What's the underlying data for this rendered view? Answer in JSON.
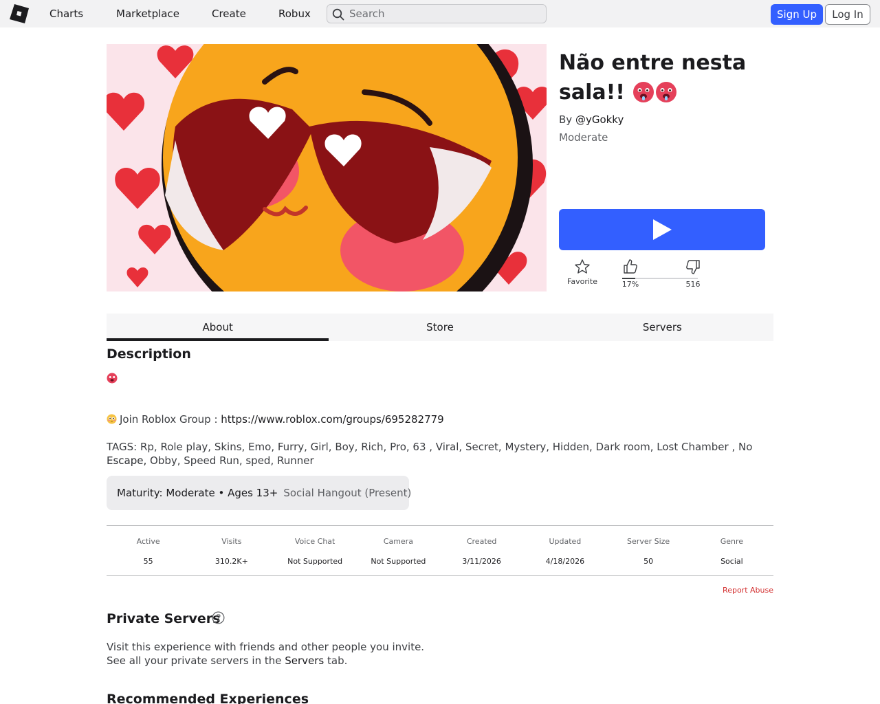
{
  "nav": {
    "links": [
      "Charts",
      "Marketplace",
      "Create",
      "Robux"
    ],
    "search_placeholder": "Search",
    "signup_label": "Sign Up",
    "login_label": "Log In"
  },
  "game": {
    "title": "Não entre nesta sala!!",
    "creator_prefix": "By ",
    "creator_name": "@yGokky",
    "maturity": "Moderate",
    "accent_color": "#335fff"
  },
  "votes": {
    "favorite_label": "Favorite",
    "upvote_label": "17%",
    "downvote_label": "516",
    "upvote_fraction": 0.17
  },
  "tabs": [
    {
      "label": "About",
      "active": true
    },
    {
      "label": "Store",
      "active": false
    },
    {
      "label": "Servers",
      "active": false
    }
  ],
  "description": {
    "heading": "Description",
    "join_text": "Join  Roblox Group : ",
    "join_link": "https://www.roblox.com/groups/695282779",
    "tags_line1": "TAGS: Rp, Role play, Skins, Emo, Furry,  Girl, Boy, Rich, Pro, 63 , Viral,  Secret, Mystery, Hidden, Dark room, Lost Chamber , No Escape,",
    "tags_line2": "Escape, Obby, Speed Run, sped, Runner"
  },
  "maturity_box": {
    "rating": "Maturity: Moderate",
    "separator": " • ",
    "ages": "Ages 13+",
    "genre": "Social Hangout (Present)"
  },
  "stats": [
    {
      "label": "Active",
      "value": "55"
    },
    {
      "label": "Visits",
      "value": "310.2K+"
    },
    {
      "label": "Voice Chat",
      "value": "Not Supported"
    },
    {
      "label": "Camera",
      "value": "Not Supported"
    },
    {
      "label": "Created",
      "value": "3/11/2026"
    },
    {
      "label": "Updated",
      "value": "4/18/2026"
    },
    {
      "label": "Server Size",
      "value": "50"
    },
    {
      "label": "Genre",
      "value": "Social"
    }
  ],
  "report_abuse": "Report Abuse",
  "private_servers": {
    "heading": "Private Servers",
    "line1": "Visit this experience with friends and other people you invite.",
    "line2_prefix": "See all your private servers in the ",
    "line2_strong": "Servers",
    "line2_suffix": " tab."
  },
  "recommended_heading": "Recommended Experiences"
}
